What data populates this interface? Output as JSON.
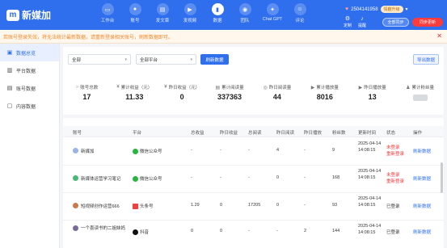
{
  "app": {
    "logo_mark": "m",
    "name": "新媒加"
  },
  "nav": [
    {
      "label": "工作台",
      "icon": "tv-icon",
      "glyph": "▭"
    },
    {
      "label": "账号",
      "icon": "user-icon",
      "glyph": "●"
    },
    {
      "label": "发文章",
      "icon": "article-icon",
      "glyph": "▤"
    },
    {
      "label": "发视频",
      "icon": "video-icon",
      "glyph": "▶"
    },
    {
      "label": "数据",
      "icon": "bar-chart-icon",
      "glyph": "▮"
    },
    {
      "label": "团队",
      "icon": "team-icon",
      "glyph": "◉"
    },
    {
      "label": "Chat GPT",
      "icon": "chat-icon",
      "glyph": "✦"
    },
    {
      "label": "评论",
      "icon": "comment-icon",
      "glyph": "☺"
    }
  ],
  "account": {
    "phone": "2504141958",
    "badge": "情趣升级"
  },
  "utils": {
    "customize": "定制",
    "bell": "提醒"
  },
  "buttons": {
    "sync_all": "全部同步",
    "sync_now": "同步更新",
    "refresh": "刷新数据",
    "export": "导出数据"
  },
  "alert": {
    "text": "若账号登录失效，将无法统计最新数据，请重新登录相关账号，刷新数据即可。"
  },
  "sidebar": [
    {
      "label": "数据总览",
      "icon": "overview-icon",
      "glyph": "▣"
    },
    {
      "label": "平台数据",
      "icon": "platform-icon",
      "glyph": "▥"
    },
    {
      "label": "账号数据",
      "icon": "account-data-icon",
      "glyph": "▤"
    },
    {
      "label": "内容数据",
      "icon": "content-data-icon",
      "glyph": "▢"
    }
  ],
  "filters": {
    "group": "全部",
    "platform": "全部平台"
  },
  "stats": [
    {
      "label": "账号总数",
      "value": "17",
      "glyph": "○"
    },
    {
      "label": "累计收益（元）",
      "value": "11.33",
      "glyph": "¥"
    },
    {
      "label": "昨日收益（元）",
      "value": "0",
      "glyph": "¥"
    },
    {
      "label": "累计阅读量",
      "value": "337363",
      "glyph": "▤"
    },
    {
      "label": "昨日阅读量",
      "value": "44",
      "glyph": "◎"
    },
    {
      "label": "累计播放量",
      "value": "8016",
      "glyph": "▶"
    },
    {
      "label": "昨日播放量",
      "value": "13",
      "glyph": "▶"
    },
    {
      "label": "累计粉丝量",
      "value": "",
      "glyph": "♟"
    }
  ],
  "table": {
    "headers": [
      "账号",
      "平台",
      "总收益",
      "昨日收益",
      "总阅读",
      "昨日阅读",
      "昨日播放",
      "粉丝数",
      "更新时间",
      "状态",
      "操作"
    ],
    "rows": [
      {
        "account": "新媒加",
        "platform": "微信公众号",
        "total_income": "-",
        "yesterday_income": "-",
        "total_read": "-",
        "yesterday_read": "4",
        "yesterday_play": "-",
        "fans": "9",
        "time": "2025-04-14 14:08:15",
        "status": "未登录",
        "status2": "重新登录",
        "action": "刷新数据"
      },
      {
        "account": "新媒体运营学习笔记",
        "platform": "微信公众号",
        "total_income": "-",
        "yesterday_income": "-",
        "total_read": "-",
        "yesterday_read": "0",
        "yesterday_play": "-",
        "fans": "168",
        "time": "2025-04-14 14:08:15",
        "status": "未登录",
        "status2": "重新登录",
        "action": "刷新数据"
      },
      {
        "account": "短视频创作运营666",
        "platform": "头条号",
        "total_income": "1.29",
        "yesterday_income": "0",
        "total_read": "17205",
        "yesterday_read": "0",
        "yesterday_play": "-",
        "fans": "93",
        "time": "2025-04-14 14:08:15",
        "status": "已登录",
        "status2": "",
        "action": "刷新数据"
      },
      {
        "account": "一个喜读书的二姐妹妈",
        "platform": "抖音",
        "total_income": "0",
        "yesterday_income": "0",
        "total_read": "-",
        "yesterday_read": "-",
        "yesterday_play": "2",
        "fans": "144",
        "time": "2025-04-14 14:08:15",
        "status": "已登录",
        "status2": "",
        "action": "刷新数据"
      }
    ]
  },
  "colors": {
    "primary": "#2f6fee",
    "danger": "#f03a3a",
    "alert_text": "#f08a2c"
  }
}
